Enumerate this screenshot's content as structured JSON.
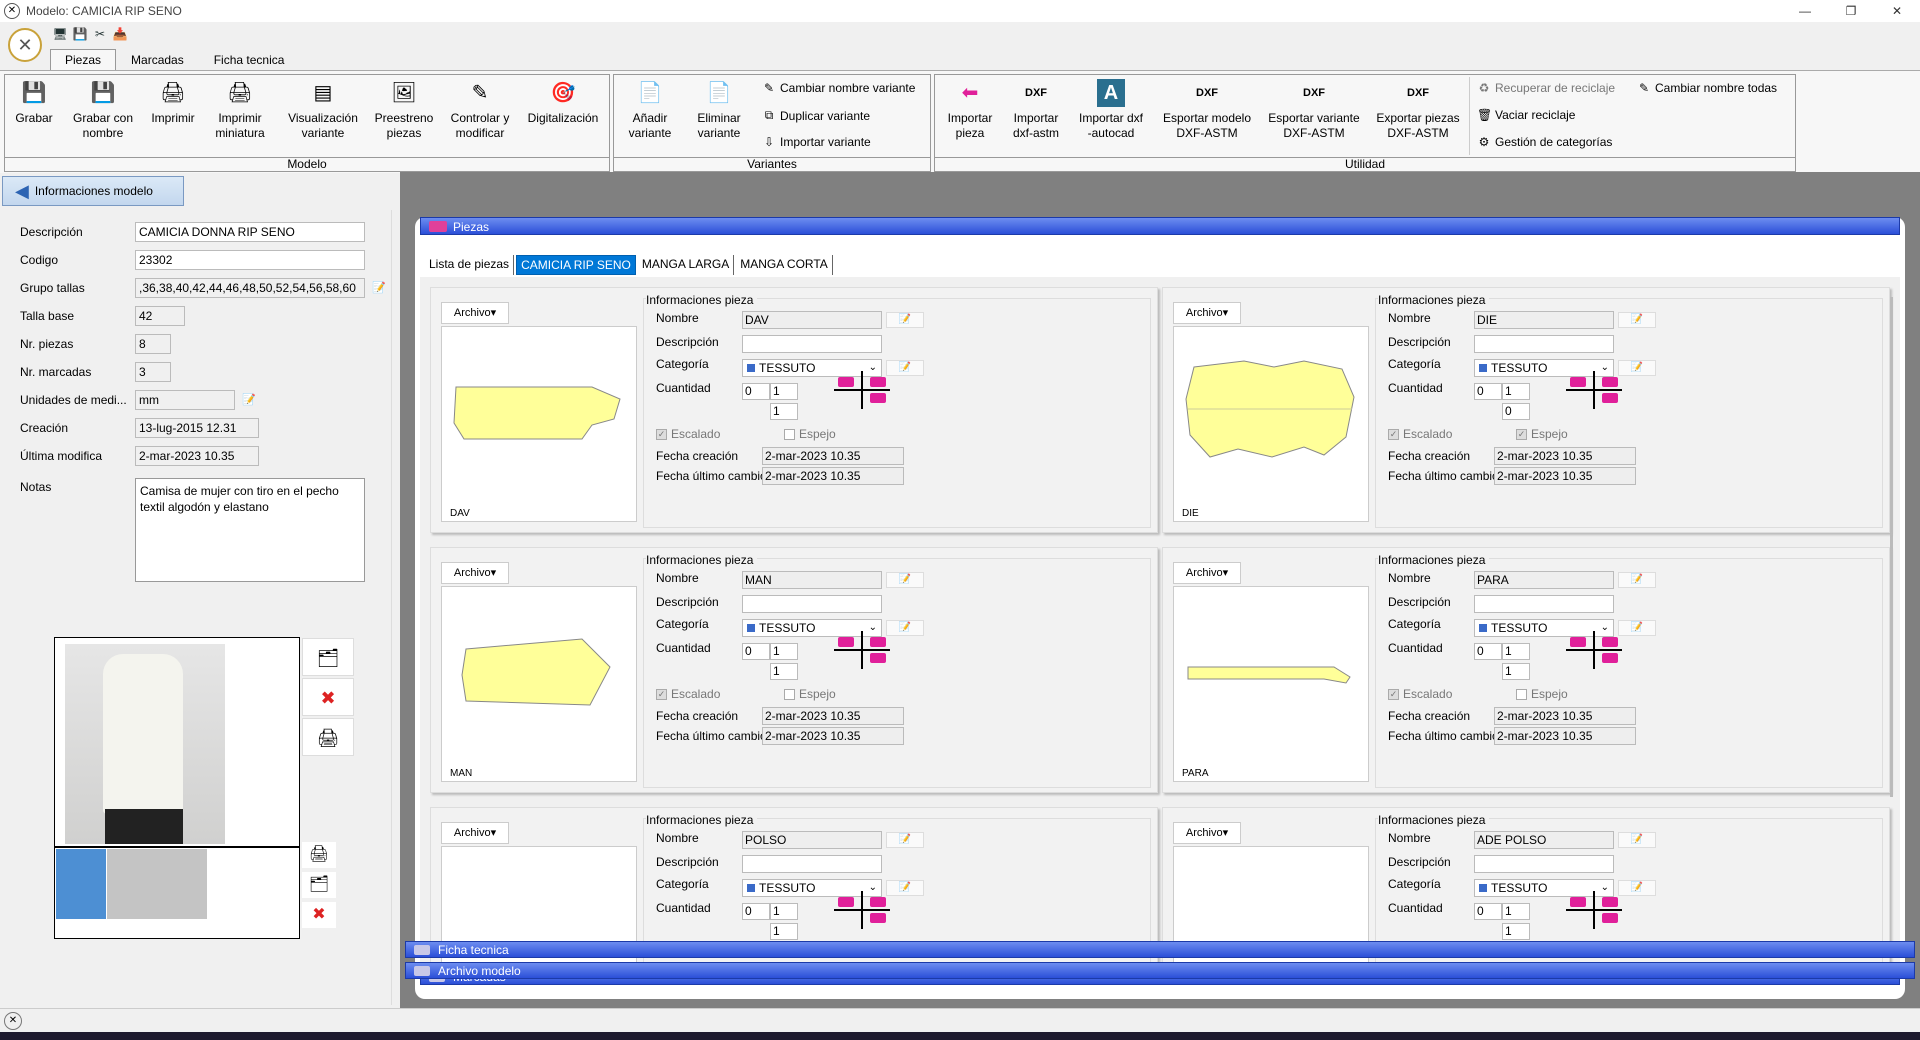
{
  "window": {
    "title": "Modelo:  CAMICIA RIP SENO",
    "minimize": "—",
    "restore": "❐",
    "close": "✕"
  },
  "qat": [
    "🖥",
    "💾",
    "✂",
    "📥"
  ],
  "tabs": [
    {
      "label": "Piezas",
      "active": true
    },
    {
      "label": "Marcadas",
      "active": false
    },
    {
      "label": "Ficha tecnica",
      "active": false
    }
  ],
  "ribbon": {
    "modelo": {
      "label": "Modelo",
      "buttons": [
        {
          "label": "Grabar",
          "icon": "💾"
        },
        {
          "label": "Grabar con\nnombre",
          "icon": "💾"
        },
        {
          "label": "Imprimir",
          "icon": "🖨"
        },
        {
          "label": "Imprimir\nminiatura",
          "icon": "🖨"
        },
        {
          "label": "Visualización\nvariante",
          "icon": "▤"
        },
        {
          "label": "Preestreno\npiezas",
          "icon": "🖼"
        },
        {
          "label": "Controlar y\nmodificar",
          "icon": "✎"
        },
        {
          "label": "Digitalización",
          "icon": "🎯"
        }
      ]
    },
    "variantes": {
      "label": "Variantes",
      "buttons": [
        {
          "label": "Añadir\nvariante",
          "icon": "📄"
        },
        {
          "label": "Eliminar\nvariante",
          "icon": "📄"
        }
      ],
      "small": [
        {
          "label": "Cambiar nombre variante",
          "icon": "✎"
        },
        {
          "label": "Duplicar variante",
          "icon": "⧉"
        },
        {
          "label": "Importar variante",
          "icon": "⇩"
        }
      ]
    },
    "utilidad": {
      "label": "Utilidad",
      "buttons": [
        {
          "label": "Importar\npieza",
          "icon": "⬅"
        },
        {
          "label": "Importar\ndxf-astm",
          "icon": "DXF"
        },
        {
          "label": "Importar dxf\n-autocad",
          "icon": "A"
        },
        {
          "label": "Esportar modelo\nDXF-ASTM",
          "icon": "DXF"
        },
        {
          "label": "Esportar variante\nDXF-ASTM",
          "icon": "DXF"
        },
        {
          "label": "Exportar piezas\nDXF-ASTM",
          "icon": "DXF"
        }
      ],
      "small": [
        {
          "label": "Recuperar de reciclaje",
          "icon": "♻",
          "disabled": true
        },
        {
          "label": "Vaciar reciclaje",
          "icon": "🗑",
          "disabled": false
        },
        {
          "label": "Gestión de categorías",
          "icon": "⚙",
          "disabled": false
        },
        {
          "label": "Cambiar nombre todas",
          "icon": "✎",
          "disabled": false
        }
      ]
    }
  },
  "info_button": "Informaciones modelo",
  "model": {
    "descripcion_label": "Descripción",
    "descripcion": "CAMICIA DONNA RIP SENO",
    "codigo_label": "Codigo",
    "codigo": "23302",
    "grupo_label": "Grupo tallas",
    "grupo": ",36,38,40,42,44,46,48,50,52,54,56,58,60",
    "talla_label": "Talla base",
    "talla": "42",
    "nrpiezas_label": "Nr. piezas",
    "nrpiezas": "8",
    "nrmarcadas_label": "Nr. marcadas",
    "nrmarcadas": "3",
    "unidades_label": "Unidades de medi...",
    "unidades": "mm",
    "creacion_label": "Creación",
    "creacion": "13-lug-2015 12.31",
    "ultima_label": "Última modifica",
    "ultima": "2-mar-2023 10.35",
    "notas_label": "Notas",
    "notas": "Camisa de mujer con tiro en el pecho\n textil algodón y elastano"
  },
  "sections": {
    "piezas": "Piezas",
    "marcadas": "Marcadas",
    "ficha": "Ficha tecnica",
    "archivo": "Archivo modelo"
  },
  "piece_tabs": [
    {
      "label": "Lista de piezas",
      "active": false
    },
    {
      "label": "CAMICIA RIP SENO",
      "active": true
    },
    {
      "label": "MANGA LARGA",
      "active": false
    },
    {
      "label": "MANGA CORTA",
      "active": false
    }
  ],
  "labels": {
    "archivo": "Archivo▾",
    "info": "Informaciones pieza",
    "nombre": "Nombre",
    "descripcion": "Descripción",
    "categoria": "Categoría",
    "cantidad": "Cuantidad",
    "escalado": "Escalado",
    "espejo": "Espejo",
    "fecha_creacion": "Fecha creación",
    "fecha_cambio": "Fecha último cambio"
  },
  "pieces": [
    {
      "name": "DAV",
      "category": "TESSUTO",
      "q0": "0",
      "q1": "1",
      "q2": "1",
      "escalado": true,
      "espejo": false,
      "created": "2-mar-2023 10.35",
      "changed": "2-mar-2023 10.35"
    },
    {
      "name": "DIE",
      "category": "TESSUTO",
      "q0": "0",
      "q1": "1",
      "q2": "0",
      "escalado": true,
      "espejo": true,
      "created": "2-mar-2023 10.35",
      "changed": "2-mar-2023 10.35"
    },
    {
      "name": "MAN",
      "category": "TESSUTO",
      "q0": "0",
      "q1": "1",
      "q2": "1",
      "escalado": true,
      "espejo": false,
      "created": "2-mar-2023 10.35",
      "changed": "2-mar-2023 10.35"
    },
    {
      "name": "PARA",
      "category": "TESSUTO",
      "q0": "0",
      "q1": "1",
      "q2": "1",
      "escalado": true,
      "espejo": false,
      "created": "2-mar-2023 10.35",
      "changed": "2-mar-2023 10.35"
    },
    {
      "name": "POLSO",
      "category": "TESSUTO",
      "q0": "0",
      "q1": "1",
      "q2": "1",
      "escalado": true,
      "espejo": false,
      "created": "",
      "changed": ""
    },
    {
      "name": "ADE POLSO",
      "category": "TESSUTO",
      "q0": "0",
      "q1": "1",
      "q2": "1",
      "escalado": true,
      "espejo": false,
      "created": "",
      "changed": ""
    }
  ],
  "colors": {
    "header_blue": "#2b4fd8",
    "piece_fill": "#ffff99",
    "symbol_pink": "#e0209a",
    "active_tab": "#0078d7"
  }
}
